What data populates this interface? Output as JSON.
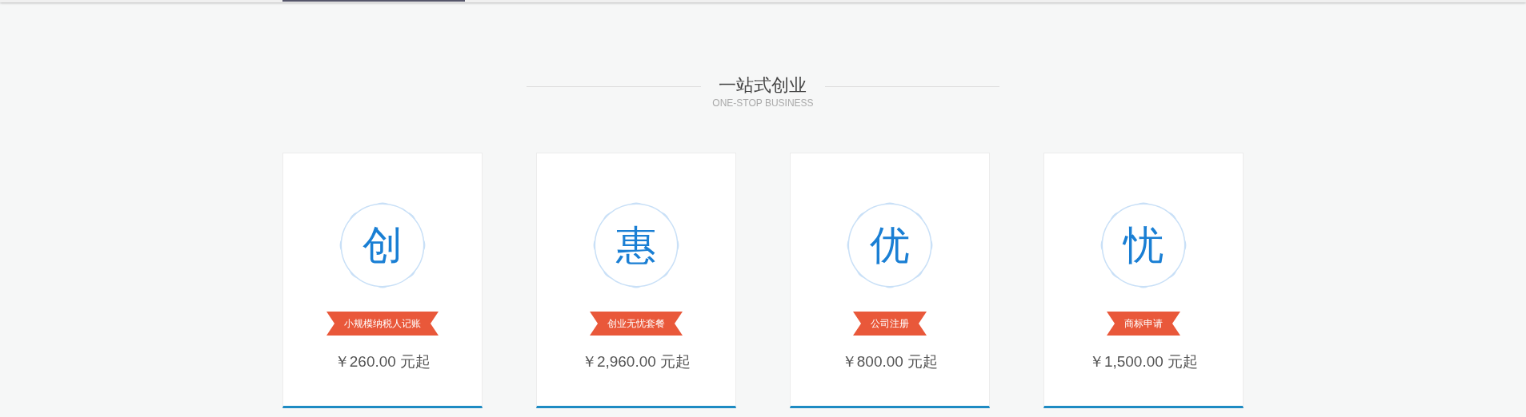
{
  "heading": {
    "title": "一站式创业",
    "subtitle": "ONE-STOP BUSINESS"
  },
  "products": [
    {
      "seal": "创",
      "tag": "小规模纳税人记账",
      "price": "￥260.00 元起"
    },
    {
      "seal": "惠",
      "tag": "创业无忧套餐",
      "price": "￥2,960.00 元起"
    },
    {
      "seal": "优",
      "tag": "公司注册",
      "price": "￥800.00 元起"
    },
    {
      "seal": "忧",
      "tag": "商标申请",
      "price": "￥1,500.00 元起"
    }
  ]
}
